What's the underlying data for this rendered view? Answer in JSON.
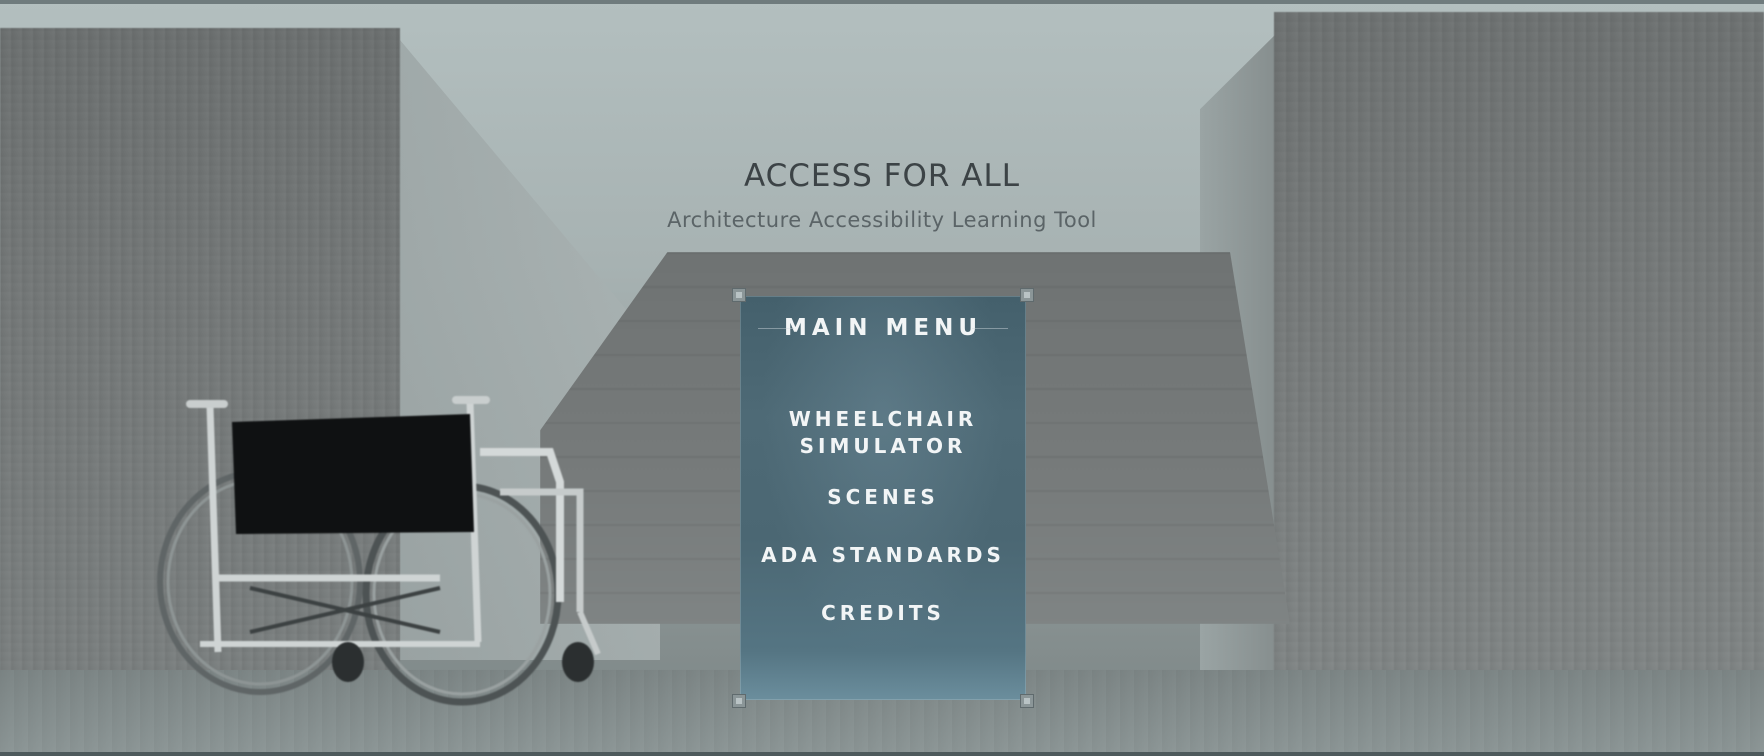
{
  "header": {
    "title": "ACCESS FOR ALL",
    "subtitle": "Architecture Accessibility Learning Tool"
  },
  "menu": {
    "heading": "MAIN MENU",
    "items": [
      {
        "label": "WHEELCHAIR SIMULATOR"
      },
      {
        "label": "SCENES"
      },
      {
        "label": "ADA STANDARDS"
      },
      {
        "label": "CREDITS"
      }
    ]
  },
  "colors": {
    "panel": "#4e6a76",
    "menu_text": "#f2f5f6",
    "title_text": "#3c4346",
    "subtitle_text": "#5b6467",
    "background_wall": "#747878"
  },
  "background": {
    "scene": "concrete-courtyard-with-stairs",
    "prop": "wheelchair-icon"
  }
}
